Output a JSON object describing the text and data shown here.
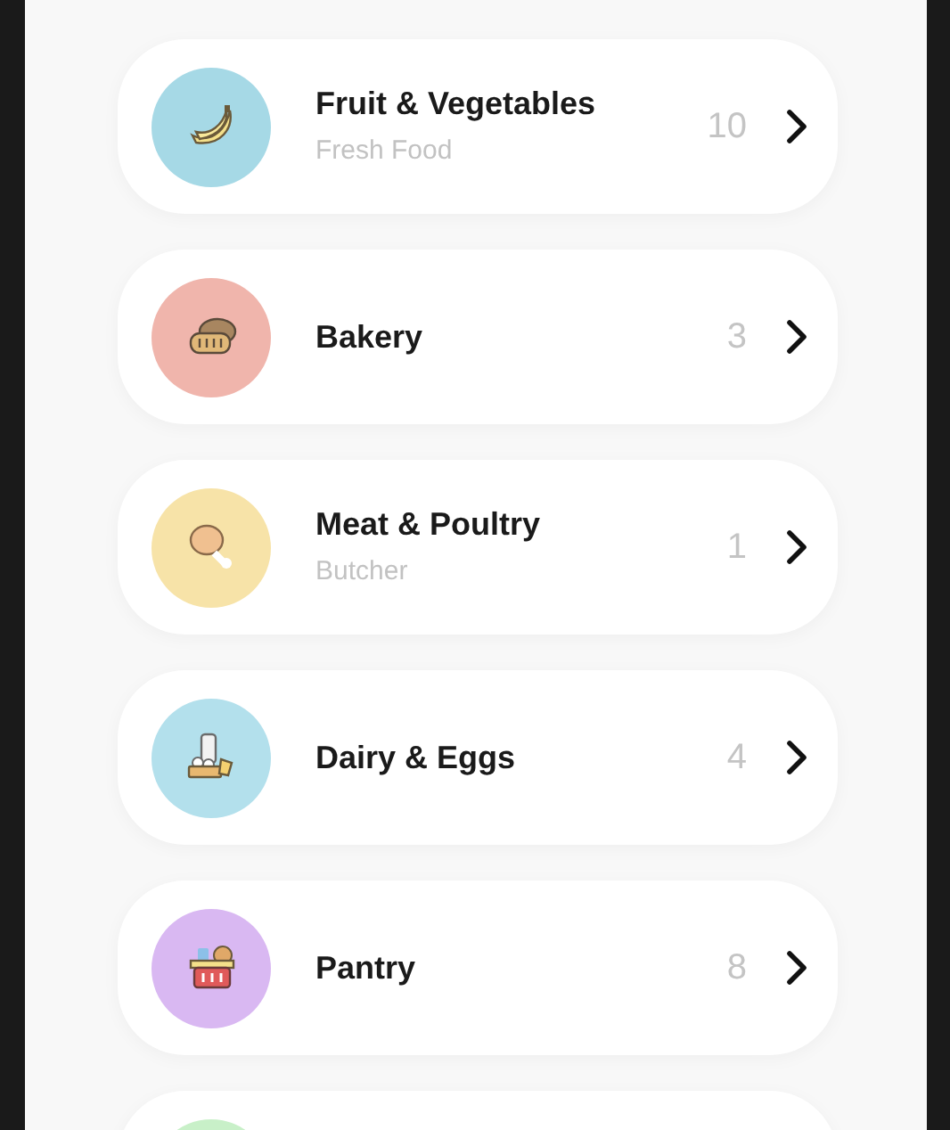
{
  "categories": [
    {
      "title": "Fruit & Vegetables",
      "subtitle": "Fresh Food",
      "count": "10",
      "color": "#a6d9e6"
    },
    {
      "title": "Bakery",
      "count": "3",
      "color": "#f0b5ac"
    },
    {
      "title": "Meat & Poultry",
      "subtitle": "Butcher",
      "count": "1",
      "color": "#f7e3a8"
    },
    {
      "title": "Dairy & Eggs",
      "count": "4",
      "color": "#b3e0ec"
    },
    {
      "title": "Pantry",
      "count": "8",
      "color": "#d9b8f2"
    },
    {
      "color": "#c8f0c8"
    }
  ]
}
